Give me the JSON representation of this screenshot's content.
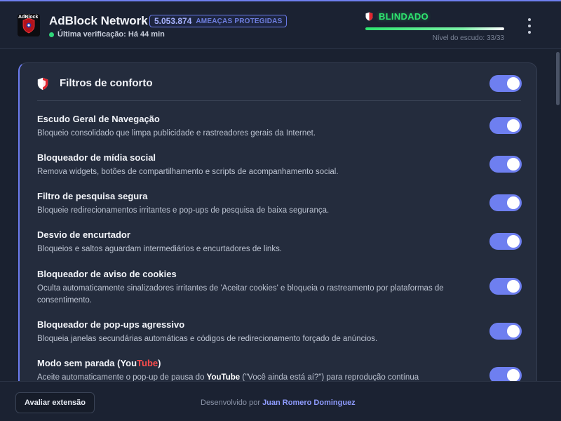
{
  "header": {
    "app_title": "AdBlock Network",
    "logo_text": "AdBlock",
    "threat_count": "5.053.874",
    "threat_label": "AMEAÇAS PROTEGIDAS",
    "last_check": "Última verificação: Há 44 min",
    "status": "BLINDADO",
    "shield_level_text": "Nível do escudo: 33/33",
    "shield_level_fraction": 1.0
  },
  "section": {
    "title": "Filtros de conforto",
    "master_toggle": true
  },
  "filters": [
    {
      "title": "Escudo Geral de Navegação",
      "desc": "Bloqueio consolidado que limpa publicidade e rastreadores gerais da Internet.",
      "enabled": true
    },
    {
      "title": "Bloqueador de mídia social",
      "desc": "Remova widgets, botões de compartilhamento e scripts de acompanhamento social.",
      "enabled": true
    },
    {
      "title": "Filtro de pesquisa segura",
      "desc": "Bloqueie redirecionamentos irritantes e pop-ups de pesquisa de baixa segurança.",
      "enabled": true
    },
    {
      "title": "Desvio de encurtador",
      "desc": "Bloqueios e saltos aguardam intermediários e encurtadores de links.",
      "enabled": true
    },
    {
      "title": "Bloqueador de aviso de cookies",
      "desc": "Oculta automaticamente sinalizadores irritantes de 'Aceitar cookies' e bloqueia o rastreamento por plataformas de consentimento.",
      "enabled": true
    },
    {
      "title": "Bloqueador de pop-ups agressivo",
      "desc": "Bloqueia janelas secundárias automáticas e códigos de redirecionamento forçado de anúncios.",
      "enabled": true
    },
    {
      "title_prefix": "Modo sem parada (You",
      "title_accent": "Tube",
      "title_suffix": ")",
      "desc_prefix": "Aceite automaticamente o pop-up de pausa do ",
      "desc_brand_a": "You",
      "desc_brand_b": "Tube",
      "desc_suffix": " (\"Você ainda está aí?\") para reprodução contínua",
      "enabled": true
    }
  ],
  "footer": {
    "rate_button": "Avaliar extensão",
    "credit_prefix": "Desenvolvido por",
    "credit_name": "Juan Romero Dominguez"
  },
  "colors": {
    "accent": "#6e7ff0",
    "status_green": "#2ee56f",
    "youtube_red": "#ff4d4d",
    "background": "#1a2130",
    "card": "#242c3d"
  },
  "icons": {
    "logo": "adblock-logo-icon",
    "status": "shield-icon",
    "section": "shield-icon",
    "menu": "more-vertical-icon"
  }
}
